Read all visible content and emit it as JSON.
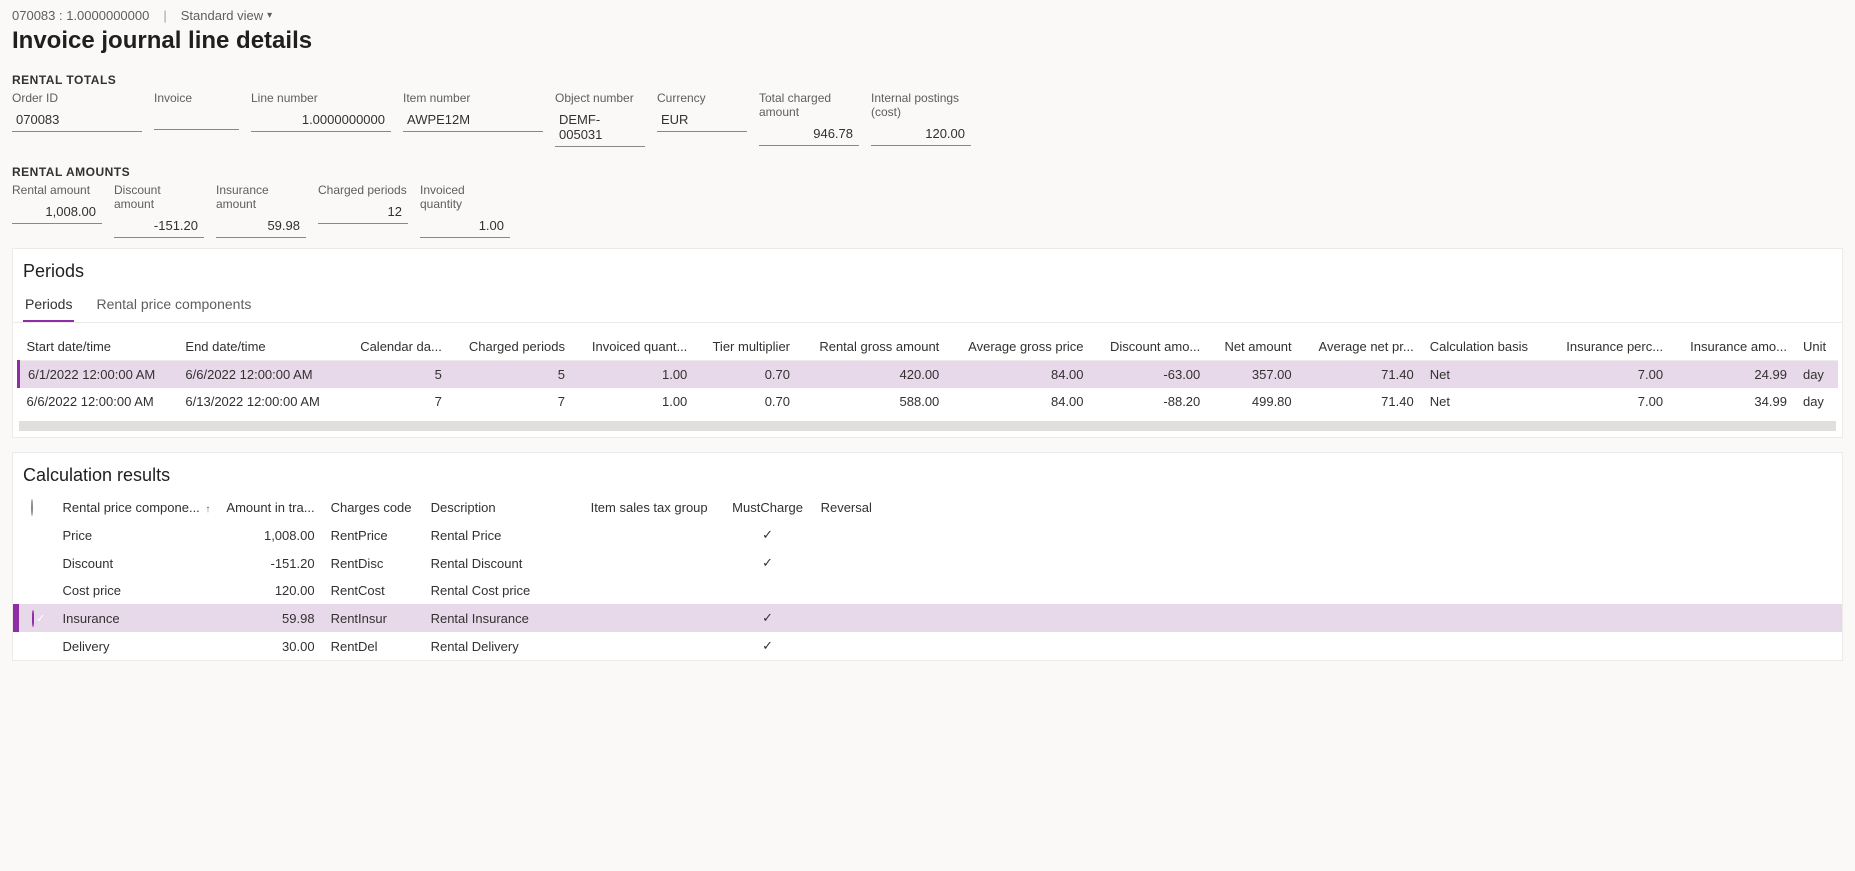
{
  "header": {
    "breadcrumb": "070083 : 1.0000000000",
    "view_label": "Standard view"
  },
  "page_title": "Invoice journal line details",
  "rental_totals": {
    "section_label": "RENTAL TOTALS",
    "fields": {
      "order_id": {
        "label": "Order ID",
        "value": "070083"
      },
      "invoice": {
        "label": "Invoice",
        "value": ""
      },
      "line_number": {
        "label": "Line number",
        "value": "1.0000000000"
      },
      "item_number": {
        "label": "Item number",
        "value": "AWPE12M"
      },
      "object_number": {
        "label": "Object number",
        "value": "DEMF-005031"
      },
      "currency": {
        "label": "Currency",
        "value": "EUR"
      },
      "total_charged": {
        "label": "Total charged amount",
        "value": "946.78"
      },
      "internal_postings": {
        "label": "Internal postings (cost)",
        "value": "120.00"
      }
    }
  },
  "rental_amounts": {
    "section_label": "RENTAL AMOUNTS",
    "fields": {
      "rental_amount": {
        "label": "Rental amount",
        "value": "1,008.00"
      },
      "discount_amount": {
        "label": "Discount amount",
        "value": "-151.20"
      },
      "insurance_amount": {
        "label": "Insurance amount",
        "value": "59.98"
      },
      "charged_periods": {
        "label": "Charged periods",
        "value": "12"
      },
      "invoiced_quantity": {
        "label": "Invoiced quantity",
        "value": "1.00"
      }
    }
  },
  "periods_panel": {
    "title": "Periods",
    "tabs": [
      "Periods",
      "Rental price components"
    ],
    "columns": [
      "Start date/time",
      "End date/time",
      "Calendar da...",
      "Charged periods",
      "Invoiced quant...",
      "Tier multiplier",
      "Rental gross amount",
      "Average gross price",
      "Discount amo...",
      "Net amount",
      "Average net pr...",
      "Calculation basis",
      "Insurance perc...",
      "Insurance amo...",
      "Unit"
    ],
    "rows": [
      {
        "selected": true,
        "start": "6/1/2022 12:00:00 AM",
        "end": "6/6/2022 12:00:00 AM",
        "caldays": "5",
        "charged": "5",
        "invqty": "1.00",
        "tier": "0.70",
        "gross": "420.00",
        "avggross": "84.00",
        "disc": "-63.00",
        "net": "357.00",
        "avgnet": "71.40",
        "basis": "Net",
        "inspct": "7.00",
        "insamt": "24.99",
        "unit": "day"
      },
      {
        "selected": false,
        "start": "6/6/2022 12:00:00 AM",
        "end": "6/13/2022 12:00:00 AM",
        "caldays": "7",
        "charged": "7",
        "invqty": "1.00",
        "tier": "0.70",
        "gross": "588.00",
        "avggross": "84.00",
        "disc": "-88.20",
        "net": "499.80",
        "avgnet": "71.40",
        "basis": "Net",
        "inspct": "7.00",
        "insamt": "34.99",
        "unit": "day"
      }
    ]
  },
  "calc_panel": {
    "title": "Calculation results",
    "columns": {
      "component": "Rental price compone...",
      "amount": "Amount in tra...",
      "code": "Charges code",
      "desc": "Description",
      "tax": "Item sales tax group",
      "must": "MustCharge",
      "rev": "Reversal"
    },
    "rows": [
      {
        "selected": false,
        "component": "Price",
        "amount": "1,008.00",
        "code": "RentPrice",
        "desc": "Rental Price",
        "tax": "",
        "must": true,
        "rev": false
      },
      {
        "selected": false,
        "component": "Discount",
        "amount": "-151.20",
        "code": "RentDisc",
        "desc": "Rental Discount",
        "tax": "",
        "must": true,
        "rev": false
      },
      {
        "selected": false,
        "component": "Cost price",
        "amount": "120.00",
        "code": "RentCost",
        "desc": "Rental Cost price",
        "tax": "",
        "must": false,
        "rev": false
      },
      {
        "selected": true,
        "component": "Insurance",
        "amount": "59.98",
        "code": "RentInsur",
        "desc": "Rental Insurance",
        "tax": "",
        "must": true,
        "rev": false
      },
      {
        "selected": false,
        "component": "Delivery",
        "amount": "30.00",
        "code": "RentDel",
        "desc": "Rental Delivery",
        "tax": "",
        "must": true,
        "rev": false
      }
    ]
  }
}
